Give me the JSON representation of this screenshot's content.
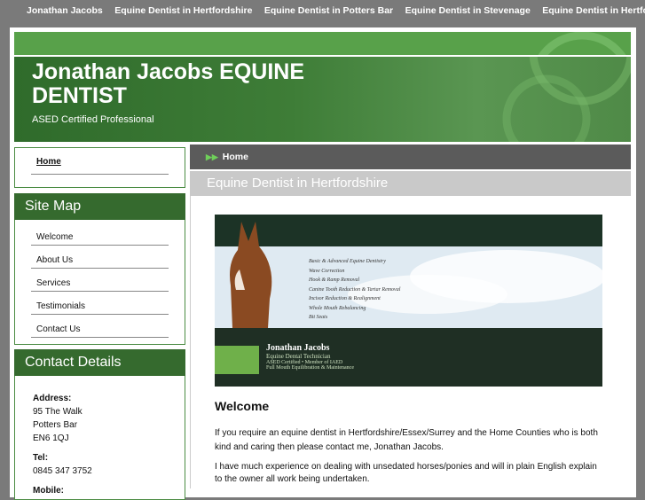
{
  "topnav": {
    "items": [
      "Jonathan Jacobs",
      "Equine Dentist in Hertfordshire",
      "Equine Dentist in Potters Bar",
      "Equine Dentist in Stevenage",
      "Equine Dentist in Hertford"
    ]
  },
  "header": {
    "title_line1": "Jonathan Jacobs EQUINE",
    "title_line2": "DENTIST",
    "tagline": "ASED Certified Professional"
  },
  "sidebar": {
    "home_link": "Home",
    "sitemap_title": "Site Map",
    "sitemap_items": [
      "Welcome",
      "About Us",
      "Services",
      "Testimonials",
      "Contact Us"
    ],
    "contact_title": "Contact Details",
    "address_label": "Address:",
    "address_lines": [
      "95 The Walk",
      "Potters Bar",
      "EN6 1QJ"
    ],
    "tel_label": "Tel:",
    "tel": "0845 347 3752",
    "mobile_label": "Mobile:"
  },
  "breadcrumb": {
    "label": "Home"
  },
  "page": {
    "subtitle": "Equine Dentist in Hertfordshire",
    "welcome_heading": "Welcome",
    "paragraph1": "If you require an equine dentist in Hertfordshire/Essex/Surrey and the Home Counties who is both kind and caring then please contact me, Jonathan Jacobs.",
    "paragraph2": "I have much experience on dealing with unsedated horses/ponies and will in plain English explain to the owner all work being undertaken."
  },
  "hero": {
    "services": [
      "Basic & Advanced Equine Dentistry",
      "Wave Correction",
      "Hook & Ramp Removal",
      "Canine Tooth Reduction & Tartar Removal",
      "Incisor Reduction & Realignment",
      "Whole Mouth Rebalancing",
      "Bit Seats"
    ],
    "name": "Jonathan Jacobs",
    "role": "Equine Dental Technician",
    "cert": "ASED Certified • Member of IAED",
    "note": "Full Mouth Equilibration & Maintenance"
  },
  "colors": {
    "brand_green": "#356a2e",
    "bright_green": "#58a14a",
    "nav_grey": "#7a7a7a"
  }
}
